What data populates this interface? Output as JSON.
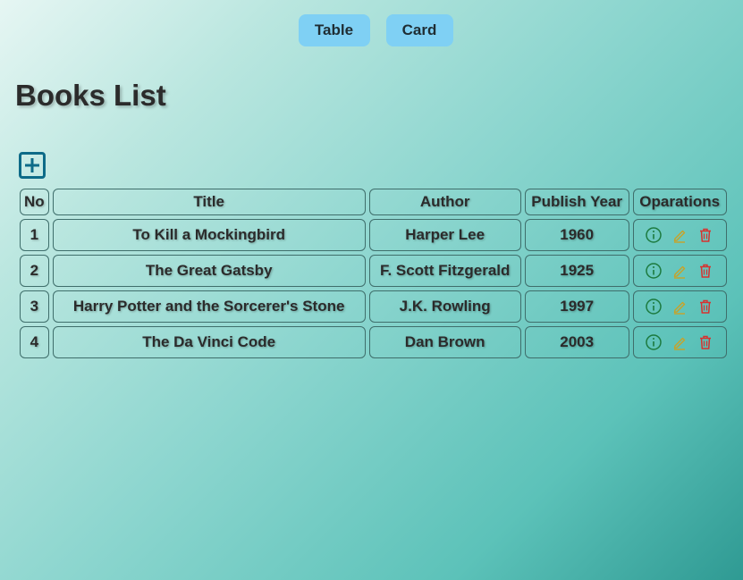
{
  "view_toggle": {
    "table_label": "Table",
    "card_label": "Card"
  },
  "page_title": "Books List",
  "table": {
    "headers": {
      "no": "No",
      "title": "Title",
      "author": "Author",
      "year": "Publish Year",
      "operations": "Oparations"
    },
    "rows": [
      {
        "no": "1",
        "title": "To Kill a Mockingbird",
        "author": "Harper Lee",
        "year": "1960"
      },
      {
        "no": "2",
        "title": "The Great Gatsby",
        "author": "F. Scott Fitzgerald",
        "year": "1925"
      },
      {
        "no": "3",
        "title": "Harry Potter and the Sorcerer's Stone",
        "author": "J.K. Rowling",
        "year": "1997"
      },
      {
        "no": "4",
        "title": "The Da Vinci Code",
        "author": "Dan Brown",
        "year": "2003"
      }
    ]
  },
  "icons": {
    "add": "plus-square-icon",
    "info": "info-circle-icon",
    "edit": "pencil-icon",
    "delete": "trash-icon"
  },
  "colors": {
    "toggle_button": "#7fd0f4",
    "add_icon": "#0d6b88",
    "info_icon": "#1c7a3e",
    "edit_icon": "#c9a227",
    "delete_icon": "#d8312e"
  }
}
